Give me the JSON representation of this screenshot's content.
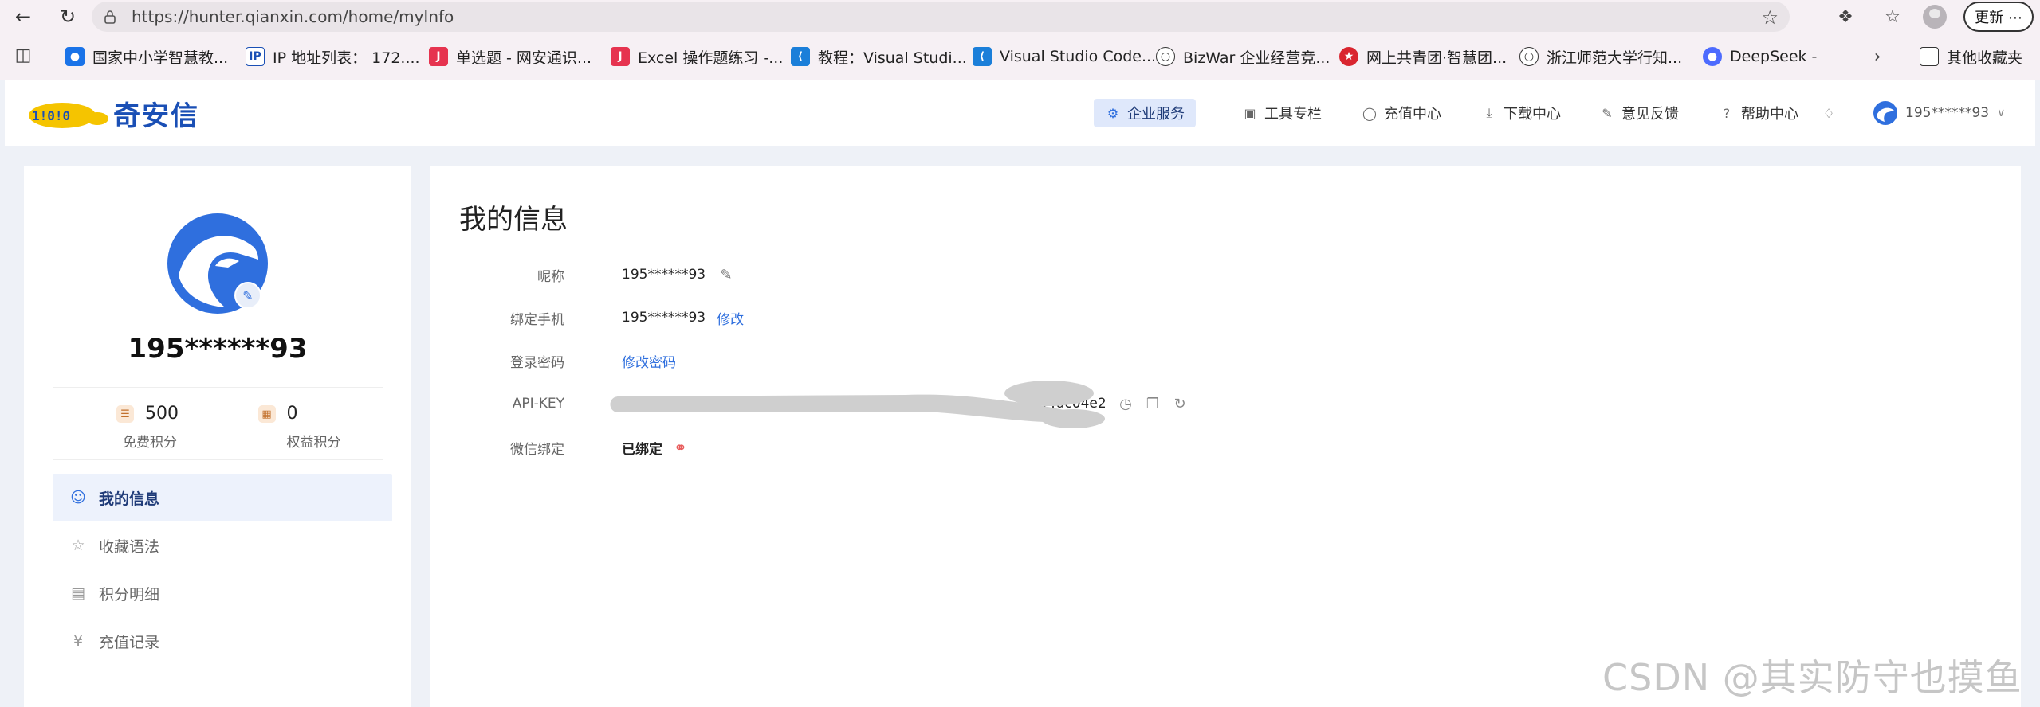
{
  "browser": {
    "url": "https://hunter.qianxin.com/home/myInfo",
    "update_label": "更新 ⋯",
    "bookmarks": [
      {
        "label": "国家中小学智慧教...",
        "icon": "smartedu-icon",
        "color": "#1a73e8"
      },
      {
        "label": "IP 地址列表： 172....",
        "icon": "ip-icon",
        "color": "#ffffff"
      },
      {
        "label": "单选题 - 网安通识...",
        "icon": "quiz-icon",
        "color": "#e6334f"
      },
      {
        "label": "Excel 操作题练习 -...",
        "icon": "quiz-icon",
        "color": "#e6334f"
      },
      {
        "label": "教程：Visual Studi...",
        "icon": "vscode-icon",
        "color": "#1b7fd9"
      },
      {
        "label": "Visual Studio Code...",
        "icon": "vscode-icon",
        "color": "#1b7fd9"
      },
      {
        "label": "BizWar 企业经营竞...",
        "icon": "globe-icon",
        "color": "#ffffff"
      },
      {
        "label": "网上共青团·智慧团...",
        "icon": "league-icon",
        "color": "#d9252f"
      },
      {
        "label": "浙江师范大学行知...",
        "icon": "globe-icon",
        "color": "#ffffff"
      },
      {
        "label": "DeepSeek -",
        "icon": "deepseek-icon",
        "color": "#4d6bfe"
      }
    ],
    "other_bookmarks": "其他收藏夹"
  },
  "header": {
    "logo_text": "奇安信",
    "nav": [
      {
        "label": "企业服务",
        "icon": "enterprise-icon",
        "active": true
      },
      {
        "label": "工具专栏",
        "icon": "toolbox-icon",
        "active": false
      },
      {
        "label": "充值中心",
        "icon": "recharge-icon",
        "active": false
      },
      {
        "label": "下载中心",
        "icon": "download-icon",
        "active": false
      },
      {
        "label": "意见反馈",
        "icon": "feedback-icon",
        "active": false
      },
      {
        "label": "帮助中心",
        "icon": "help-icon",
        "active": false
      }
    ],
    "username": "195******93"
  },
  "sidebar": {
    "username": "195******93",
    "points": [
      {
        "value": "500",
        "label": "免费积分"
      },
      {
        "value": "0",
        "label": "权益积分"
      }
    ],
    "menu": [
      {
        "label": "我的信息",
        "icon": "user-icon",
        "active": true
      },
      {
        "label": "收藏语法",
        "icon": "star-icon",
        "active": false
      },
      {
        "label": "积分明细",
        "icon": "document-icon",
        "active": false
      },
      {
        "label": "充值记录",
        "icon": "coin-icon",
        "active": false
      }
    ]
  },
  "main": {
    "title": "我的信息",
    "rows": {
      "nickname": {
        "label": "昵称",
        "value": "195******93"
      },
      "phone": {
        "label": "绑定手机",
        "value": "195******93",
        "action": "修改"
      },
      "password": {
        "label": "登录密码",
        "action": "修改密码"
      },
      "apikey": {
        "label": "API-KEY",
        "visible_tail": "9f4dc04e2"
      },
      "wechat": {
        "label": "微信绑定",
        "value": "已绑定"
      }
    }
  },
  "watermark": "CSDN @其实防守也摸鱼",
  "colors": {
    "accent": "#2f6fde",
    "brand": "#1a4fb5",
    "unlink": "#e85a5a"
  }
}
